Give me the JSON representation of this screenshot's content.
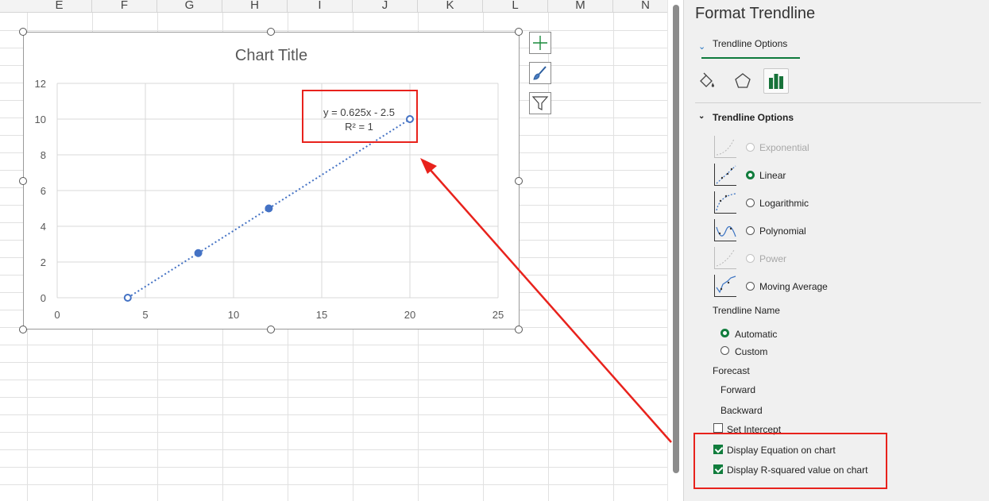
{
  "sheet": {
    "columns": [
      "E",
      "F",
      "G",
      "H",
      "I",
      "J",
      "K",
      "L",
      "M",
      "N"
    ]
  },
  "chart": {
    "title": "Chart Title",
    "equation": "y = 0.625x - 2.5",
    "r_squared_label": "R² = 1"
  },
  "chart_data": {
    "type": "scatter",
    "title": "Chart Title",
    "series": [
      {
        "name": "",
        "x": [
          4,
          8,
          12,
          20
        ],
        "y": [
          0,
          2.5,
          5,
          10
        ]
      }
    ],
    "trendline": {
      "type": "linear",
      "slope": 0.625,
      "intercept": -2.5,
      "x_range": [
        4,
        20
      ],
      "style": "dotted"
    },
    "xlim": [
      0,
      25
    ],
    "ylim": [
      0,
      12
    ],
    "xticks": [
      0,
      5,
      10,
      15,
      20,
      25
    ],
    "yticks": [
      0,
      2,
      4,
      6,
      8,
      10,
      12
    ],
    "xlabel": "",
    "ylabel": "",
    "grid": true,
    "series_color": "#4472c4"
  },
  "pane": {
    "title": "Format Trendline",
    "tab_label": "Trendline Options",
    "section_label": "Trendline Options",
    "types": [
      {
        "label": "Exponential",
        "checked": false,
        "disabled": true,
        "icon": "exponential-trendline-icon"
      },
      {
        "label": "Linear",
        "checked": true,
        "disabled": false,
        "icon": "linear-trendline-icon"
      },
      {
        "label": "Logarithmic",
        "checked": false,
        "disabled": false,
        "icon": "logarithmic-trendline-icon"
      },
      {
        "label": "Polynomial",
        "checked": false,
        "disabled": false,
        "icon": "polynomial-trendline-icon"
      },
      {
        "label": "Power",
        "checked": false,
        "disabled": true,
        "icon": "power-trendline-icon"
      },
      {
        "label": "Moving Average",
        "checked": false,
        "disabled": false,
        "icon": "moving-average-trendline-icon"
      }
    ],
    "trendline_name_label": "Trendline Name",
    "name_automatic": "Automatic",
    "name_custom": "Custom",
    "forecast_label": "Forecast",
    "forward_label": "Forward",
    "backward_label": "Backward",
    "set_intercept_label": "Set Intercept",
    "display_equation_label": "Display Equation on chart",
    "display_rsquared_label": "Display R-squared value on chart",
    "display_equation_checked": true,
    "display_rsquared_checked": true
  },
  "colors": {
    "accent_green": "#117d3d",
    "annotation_red": "#e8221c",
    "series_blue": "#4472c4"
  }
}
